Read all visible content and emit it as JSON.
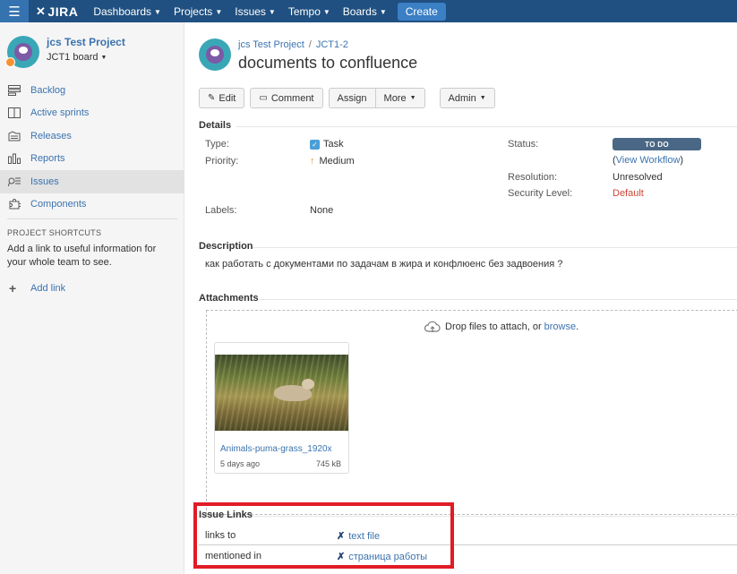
{
  "nav": {
    "logo": "JIRA",
    "items": [
      "Dashboards",
      "Projects",
      "Issues",
      "Tempo",
      "Boards"
    ],
    "create": "Create"
  },
  "sidebar": {
    "project_name": "jcs Test Project",
    "board_name": "JCT1 board",
    "items": [
      {
        "label": "Backlog",
        "icon": "backlog-icon"
      },
      {
        "label": "Active sprints",
        "icon": "sprints-icon"
      },
      {
        "label": "Releases",
        "icon": "releases-icon"
      },
      {
        "label": "Reports",
        "icon": "reports-icon"
      },
      {
        "label": "Issues",
        "icon": "issues-icon"
      },
      {
        "label": "Components",
        "icon": "components-icon"
      }
    ],
    "active_index": 4,
    "shortcuts_title": "PROJECT SHORTCUTS",
    "shortcuts_text": "Add a link to useful information for your whole team to see.",
    "add_link": "Add link"
  },
  "issue": {
    "project": "jcs Test Project",
    "key": "JCT1-2",
    "title": "documents to confluence"
  },
  "toolbar": {
    "edit": "Edit",
    "comment": "Comment",
    "assign": "Assign",
    "more": "More",
    "admin": "Admin"
  },
  "details": {
    "heading": "Details",
    "type_label": "Type:",
    "type_value": "Task",
    "priority_label": "Priority:",
    "priority_value": "Medium",
    "labels_label": "Labels:",
    "labels_value": "None",
    "status_label": "Status:",
    "status_value": "TO DO",
    "workflow_open": "(",
    "workflow_link": "View Workflow",
    "workflow_close": ")",
    "resolution_label": "Resolution:",
    "resolution_value": "Unresolved",
    "security_label": "Security Level:",
    "security_value": "Default"
  },
  "description": {
    "heading": "Description",
    "text": "как работать с документами по задачам в жира и конфлюенс без задвоения ?"
  },
  "attachments": {
    "heading": "Attachments",
    "drop_text": "Drop files to attach, or ",
    "browse": "browse",
    "drop_end": ".",
    "file_name": "Animals-puma-grass_1920x",
    "file_age": "5 days ago",
    "file_size": "745 kB"
  },
  "issue_links": {
    "heading": "Issue Links",
    "rows": [
      {
        "label": "links to",
        "target": "text file"
      },
      {
        "label": "mentioned in",
        "target": "страница работы"
      }
    ]
  },
  "colors": {
    "nav_bg": "#205081",
    "link": "#3b73af",
    "status_lozenge": "#4a6785",
    "highlight_box": "#e11c24"
  }
}
